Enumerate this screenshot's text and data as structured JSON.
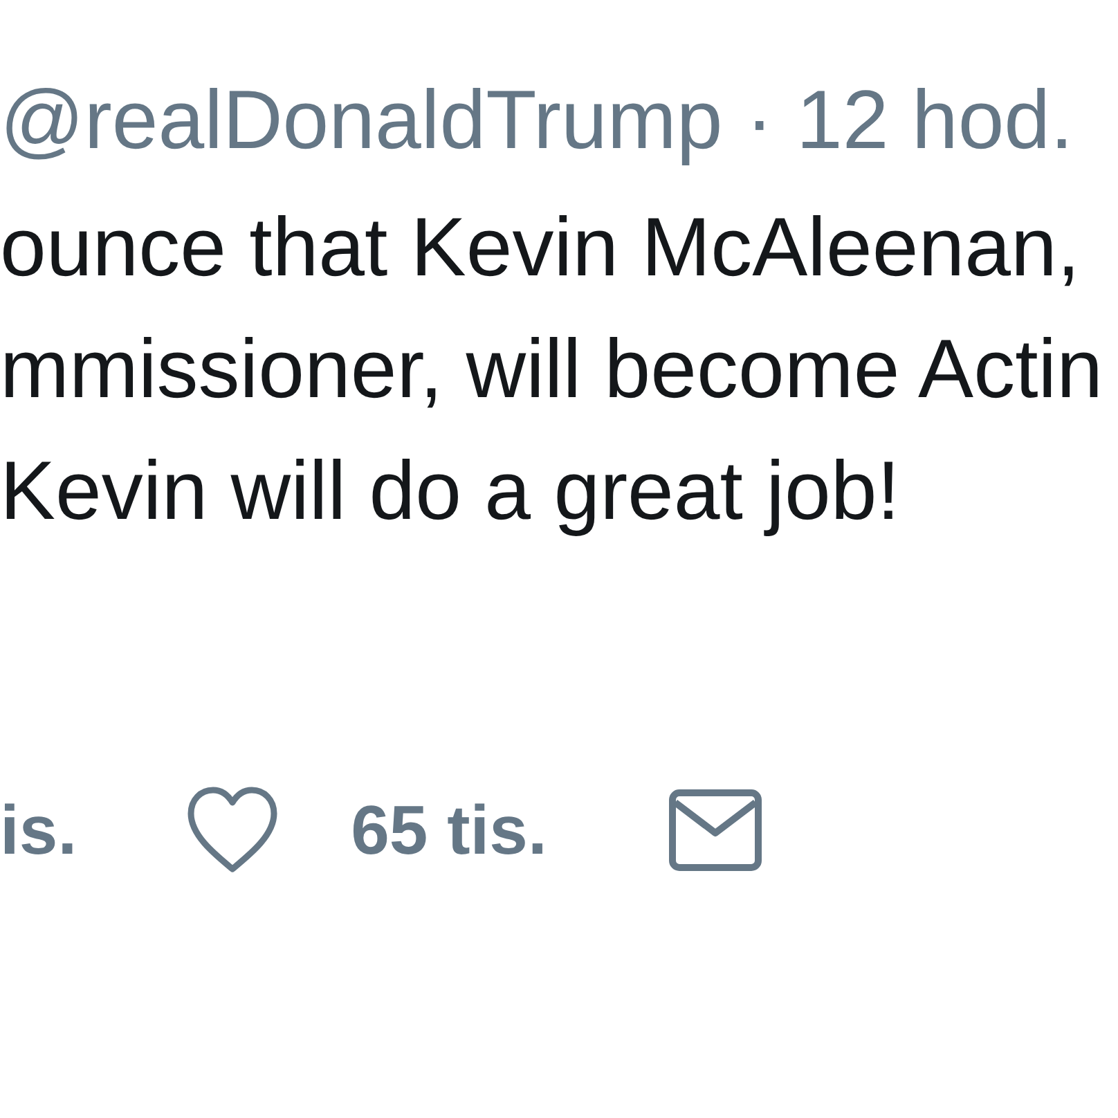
{
  "tweet": {
    "byline": "@realDonaldTrump · 12 hod.",
    "text_lines": [
      "ounce that Kevin McAleenan,",
      "mmissioner, will become Actin",
      "Kevin will do a great job!"
    ]
  },
  "actions": [
    {
      "kind": "count",
      "count": "is."
    },
    {
      "kind": "like",
      "count": "65 tis."
    },
    {
      "kind": "message"
    }
  ]
}
